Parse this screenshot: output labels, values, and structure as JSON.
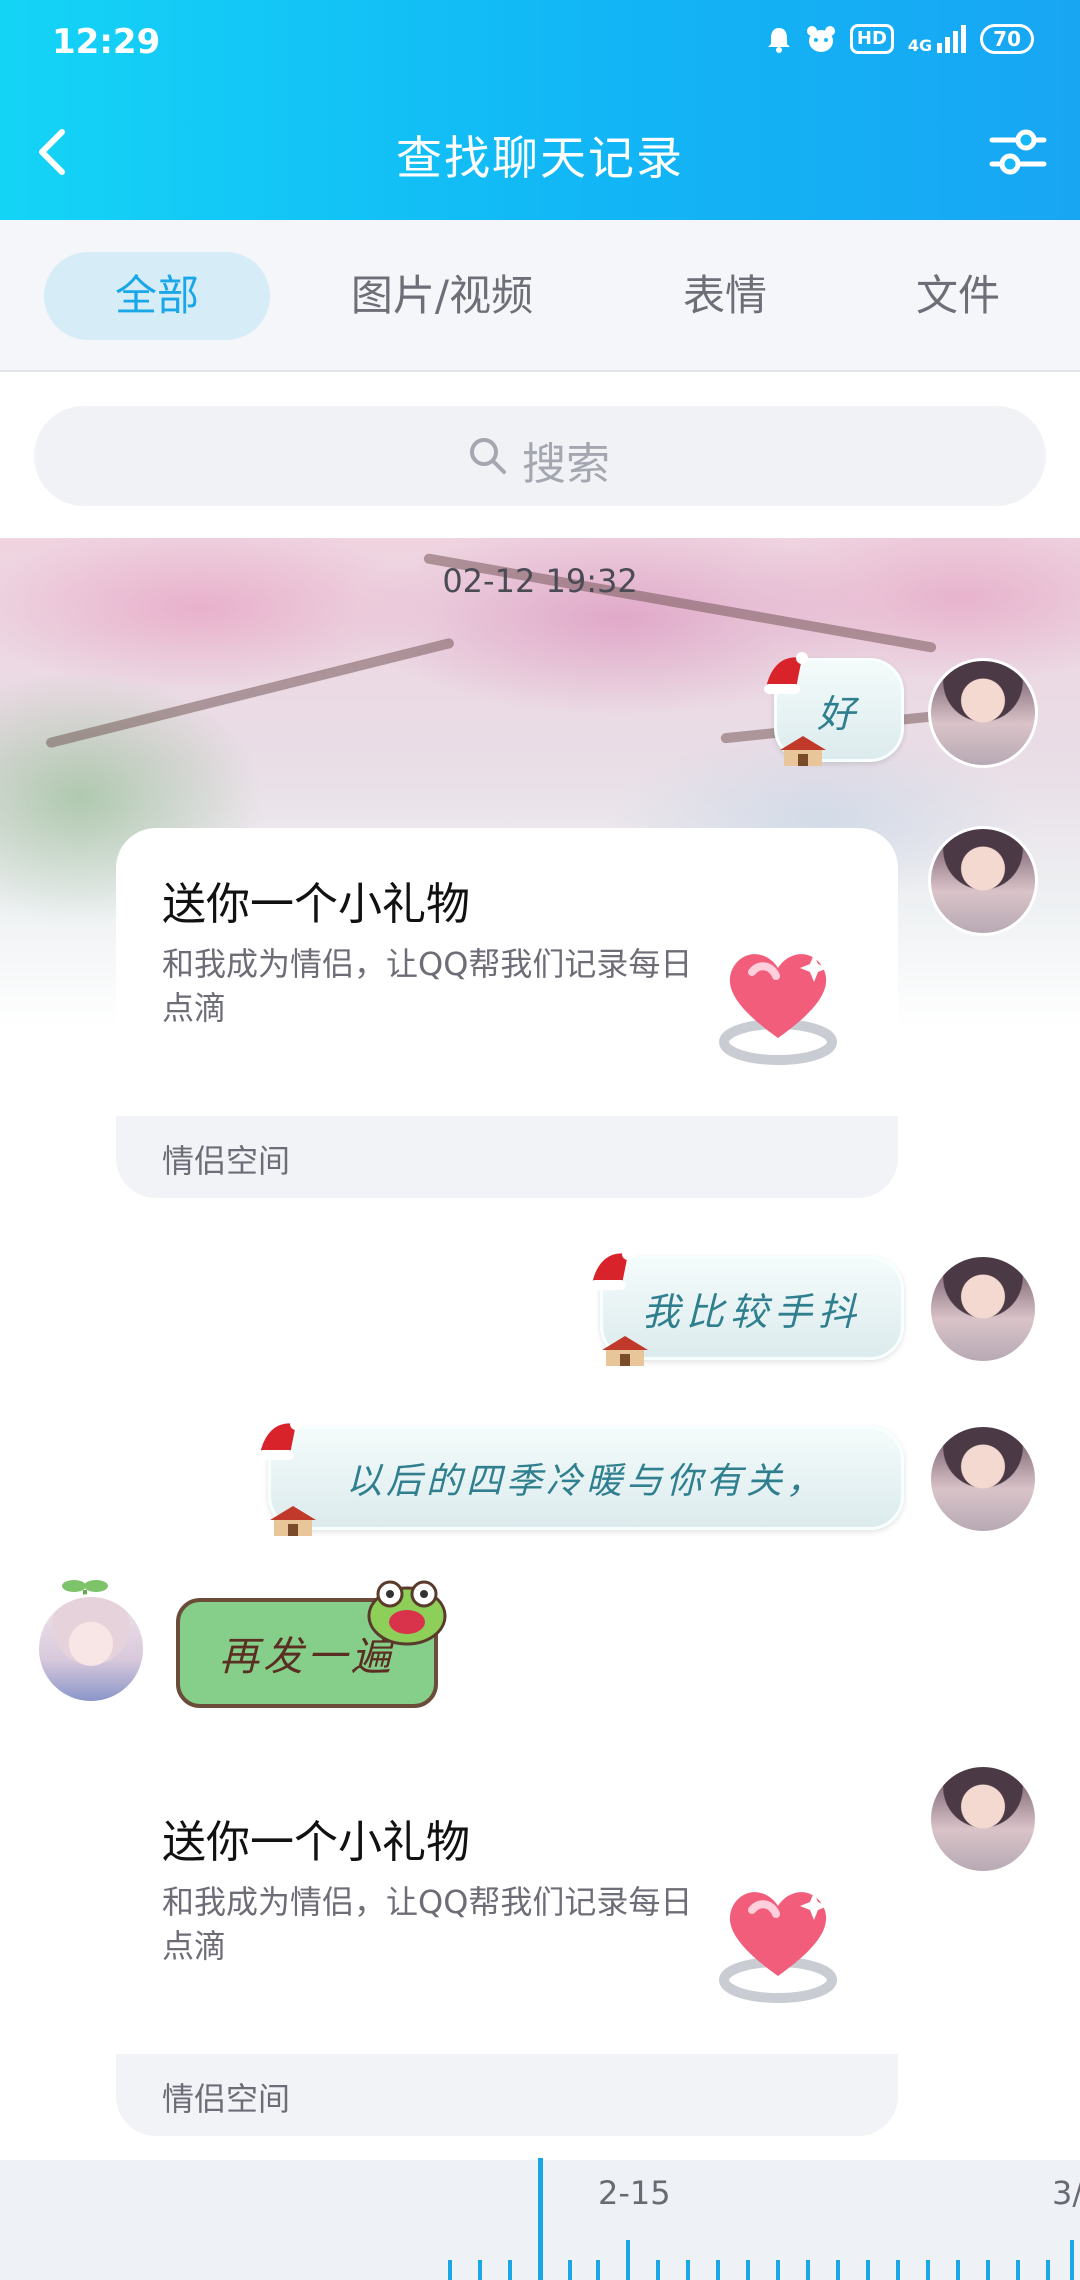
{
  "status_bar": {
    "time": "12:29",
    "icons": [
      "alarm-icon",
      "bear-icon",
      "hd-icon",
      "signal-4g-icon",
      "battery-icon"
    ],
    "hd_label": "HD",
    "network_label": "4G",
    "battery_level": "70"
  },
  "header": {
    "title": "查找聊天记录",
    "back_icon": "chevron-left-icon",
    "filter_icon": "sliders-icon"
  },
  "tabs": [
    {
      "label": "全部",
      "active": true
    },
    {
      "label": "图片/视频",
      "active": false
    },
    {
      "label": "表情",
      "active": false
    },
    {
      "label": "文件",
      "active": false
    }
  ],
  "search": {
    "placeholder": "搜索"
  },
  "chat": {
    "timestamp": "02-12 19:32",
    "messages": [
      {
        "type": "text",
        "side": "right",
        "text": "好"
      },
      {
        "type": "card",
        "side": "right",
        "title": "送你一个小礼物",
        "desc": "和我成为情侣，让QQ帮我们记录每日点滴",
        "footer": "情侣空间"
      },
      {
        "type": "text",
        "side": "right",
        "text": "我比较手抖"
      },
      {
        "type": "text",
        "side": "right",
        "text": "以后的四季冷暖与你有关，"
      },
      {
        "type": "text",
        "side": "left",
        "text": "再发一遍"
      },
      {
        "type": "card",
        "side": "right",
        "title": "送你一个小礼物",
        "desc": "和我成为情侣，让QQ帮我们记录每日点滴",
        "footer": "情侣空间"
      }
    ]
  },
  "timeline": {
    "labels": [
      "2-15",
      "3/"
    ]
  },
  "colors": {
    "accent": "#12b6f5",
    "tab_active_bg": "#d6ecf7",
    "tab_active_text": "#1aa7e8",
    "marker": "#17a6e3"
  }
}
